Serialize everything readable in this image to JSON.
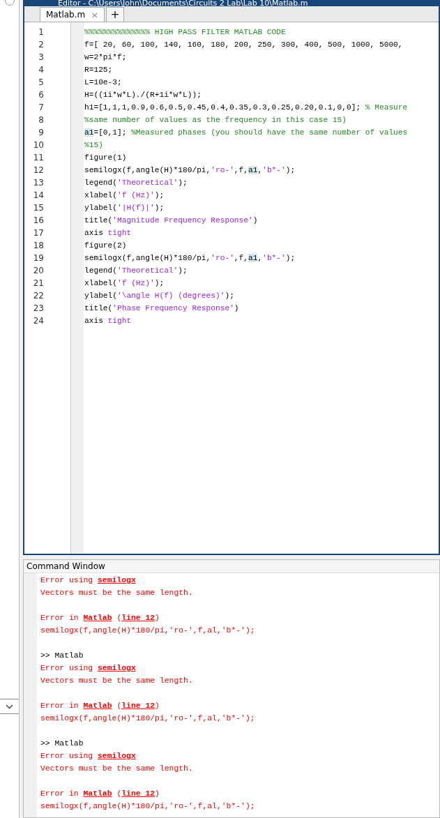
{
  "window": {
    "title": "Editor - C:\\Users\\John\\Documents\\Circuits 2 Lab\\Lab 10\\Matlab.m"
  },
  "tabs": [
    {
      "label": "Matlab.m",
      "selected": true,
      "close": "×"
    }
  ],
  "new_tab": "+",
  "editor": {
    "lines": [
      {
        "number": "1",
        "segments": [
          {
            "kind": "comment",
            "text": "%%%%%%%%%%%%%% HIGH PASS FILTER MATLAB CODE"
          }
        ]
      },
      {
        "number": "2",
        "segments": [
          {
            "kind": "code",
            "text": "f=[ 20, 60, 100, 140, 160, 180, 200, 250, 300, 400, 500, 1000, 5000, "
          }
        ]
      },
      {
        "number": "3",
        "segments": [
          {
            "kind": "code",
            "text": "w=2*pi*f;"
          }
        ]
      },
      {
        "number": "4",
        "segments": [
          {
            "kind": "code",
            "text": "R=125;"
          }
        ]
      },
      {
        "number": "5",
        "segments": [
          {
            "kind": "code",
            "text": "L=10e-3;"
          }
        ]
      },
      {
        "number": "6",
        "segments": [
          {
            "kind": "code",
            "text": "H=((1i*w*L)./(R+1i*w*L));"
          }
        ]
      },
      {
        "number": "7",
        "segments": [
          {
            "kind": "code",
            "text": "h1=[1,1,1,0.9,0.6,0.5,0.45,0.4,0.35,0.3,0.25,0.20,0.1,0,0]; "
          },
          {
            "kind": "comment",
            "text": "% Measure"
          }
        ]
      },
      {
        "number": "8",
        "segments": [
          {
            "kind": "comment",
            "text": "%same number of values as the frequency in this case 15)"
          }
        ]
      },
      {
        "number": "9",
        "segments": [
          {
            "kind": "highlight",
            "text": "a1"
          },
          {
            "kind": "code",
            "text": "=[0,1]; "
          },
          {
            "kind": "comment",
            "text": "%Measured phases (you should have the same number of values"
          }
        ]
      },
      {
        "number": "10",
        "segments": [
          {
            "kind": "comment",
            "text": "%15)"
          }
        ]
      },
      {
        "number": "11",
        "segments": [
          {
            "kind": "code",
            "text": "figure(1)"
          }
        ]
      },
      {
        "number": "12",
        "segments": [
          {
            "kind": "code",
            "text": "semilogx(f,angle(H)*180/pi,"
          },
          {
            "kind": "string",
            "text": "'ro-'"
          },
          {
            "kind": "code",
            "text": ",f,"
          },
          {
            "kind": "highlight",
            "text": "a1"
          },
          {
            "kind": "code",
            "text": ","
          },
          {
            "kind": "string",
            "text": "'b*-'"
          },
          {
            "kind": "code",
            "text": ");"
          }
        ]
      },
      {
        "number": "13",
        "segments": [
          {
            "kind": "code",
            "text": "legend("
          },
          {
            "kind": "string",
            "text": "'Theoretical'"
          },
          {
            "kind": "code",
            "text": ");"
          }
        ]
      },
      {
        "number": "14",
        "segments": [
          {
            "kind": "code",
            "text": "xlabel("
          },
          {
            "kind": "string",
            "text": "'f (Hz)'"
          },
          {
            "kind": "code",
            "text": ");"
          }
        ]
      },
      {
        "number": "15",
        "segments": [
          {
            "kind": "code",
            "text": "ylabel("
          },
          {
            "kind": "string",
            "text": "'|H(f)|'"
          },
          {
            "kind": "code",
            "text": ");"
          }
        ]
      },
      {
        "number": "16",
        "segments": [
          {
            "kind": "code",
            "text": "title("
          },
          {
            "kind": "string",
            "text": "'Magnitude Frequency Response'"
          },
          {
            "kind": "code",
            "text": ")"
          }
        ]
      },
      {
        "number": "17",
        "segments": [
          {
            "kind": "code",
            "text": "axis "
          },
          {
            "kind": "string",
            "text": "tight"
          }
        ]
      },
      {
        "number": "18",
        "segments": [
          {
            "kind": "code",
            "text": "figure(2)"
          }
        ]
      },
      {
        "number": "19",
        "segments": [
          {
            "kind": "code",
            "text": "semilogx(f,angle(H)*180/pi,"
          },
          {
            "kind": "string",
            "text": "'ro-'"
          },
          {
            "kind": "code",
            "text": ",f,"
          },
          {
            "kind": "highlight",
            "text": "a1"
          },
          {
            "kind": "code",
            "text": ","
          },
          {
            "kind": "string",
            "text": "'b*-'"
          },
          {
            "kind": "code",
            "text": ");"
          }
        ]
      },
      {
        "number": "20",
        "segments": [
          {
            "kind": "code",
            "text": "legend("
          },
          {
            "kind": "string",
            "text": "'Theoretical'"
          },
          {
            "kind": "code",
            "text": ");"
          }
        ]
      },
      {
        "number": "21",
        "segments": [
          {
            "kind": "code",
            "text": "xlabel("
          },
          {
            "kind": "string",
            "text": "'f (Hz)'"
          },
          {
            "kind": "code",
            "text": ");"
          }
        ]
      },
      {
        "number": "22",
        "segments": [
          {
            "kind": "code",
            "text": "ylabel("
          },
          {
            "kind": "string",
            "text": "'\\angle H(f) (degrees)'"
          },
          {
            "kind": "code",
            "text": ");"
          }
        ]
      },
      {
        "number": "23",
        "segments": [
          {
            "kind": "code",
            "text": "title("
          },
          {
            "kind": "string",
            "text": "'Phase Frequency Response'"
          },
          {
            "kind": "code",
            "text": ")"
          }
        ]
      },
      {
        "number": "24",
        "segments": [
          {
            "kind": "code",
            "text": "axis "
          },
          {
            "kind": "string",
            "text": "tight"
          }
        ]
      }
    ]
  },
  "command_window": {
    "title": "Command Window",
    "lines": [
      {
        "kind": "text",
        "segments": [
          {
            "kind": "error",
            "text": "Error using "
          },
          {
            "kind": "link",
            "text": "semilogx"
          }
        ]
      },
      {
        "kind": "text",
        "segments": [
          {
            "kind": "error",
            "text": "Vectors must be the same length."
          }
        ]
      },
      {
        "kind": "blank"
      },
      {
        "kind": "text",
        "segments": [
          {
            "kind": "error",
            "text": "Error in "
          },
          {
            "kind": "link",
            "text": "Matlab"
          },
          {
            "kind": "error",
            "text": " ("
          },
          {
            "kind": "link",
            "text": "line 12"
          },
          {
            "kind": "error",
            "text": ")"
          }
        ]
      },
      {
        "kind": "text",
        "segments": [
          {
            "kind": "error",
            "text": "semilogx(f,angle(H)*180/pi,'ro-',f,al,'b*-');"
          }
        ]
      },
      {
        "kind": "blank"
      },
      {
        "kind": "text",
        "segments": [
          {
            "kind": "prompt",
            "text": ">> Matlab"
          }
        ]
      },
      {
        "kind": "text",
        "segments": [
          {
            "kind": "error",
            "text": "Error using "
          },
          {
            "kind": "link",
            "text": "semilogx"
          }
        ]
      },
      {
        "kind": "text",
        "segments": [
          {
            "kind": "error",
            "text": "Vectors must be the same length."
          }
        ]
      },
      {
        "kind": "blank"
      },
      {
        "kind": "text",
        "segments": [
          {
            "kind": "error",
            "text": "Error in "
          },
          {
            "kind": "link",
            "text": "Matlab"
          },
          {
            "kind": "error",
            "text": " ("
          },
          {
            "kind": "link",
            "text": "line 12"
          },
          {
            "kind": "error",
            "text": ")"
          }
        ]
      },
      {
        "kind": "text",
        "segments": [
          {
            "kind": "error",
            "text": "semilogx(f,angle(H)*180/pi,'ro-',f,al,'b*-');"
          }
        ]
      },
      {
        "kind": "blank"
      },
      {
        "kind": "text",
        "segments": [
          {
            "kind": "prompt",
            "text": ">> Matlab"
          }
        ]
      },
      {
        "kind": "text",
        "segments": [
          {
            "kind": "error",
            "text": "Error using "
          },
          {
            "kind": "link",
            "text": "semilogx"
          }
        ]
      },
      {
        "kind": "text",
        "segments": [
          {
            "kind": "error",
            "text": "Vectors must be the same length."
          }
        ]
      },
      {
        "kind": "blank"
      },
      {
        "kind": "text",
        "segments": [
          {
            "kind": "error",
            "text": "Error in "
          },
          {
            "kind": "link",
            "text": "Matlab"
          },
          {
            "kind": "error",
            "text": " ("
          },
          {
            "kind": "link",
            "text": "line 12"
          },
          {
            "kind": "error",
            "text": ")"
          }
        ]
      },
      {
        "kind": "text",
        "segments": [
          {
            "kind": "error",
            "text": "semilogx(f,angle(H)*180/pi,'ro-',f,al,'b*-');"
          }
        ]
      }
    ]
  }
}
